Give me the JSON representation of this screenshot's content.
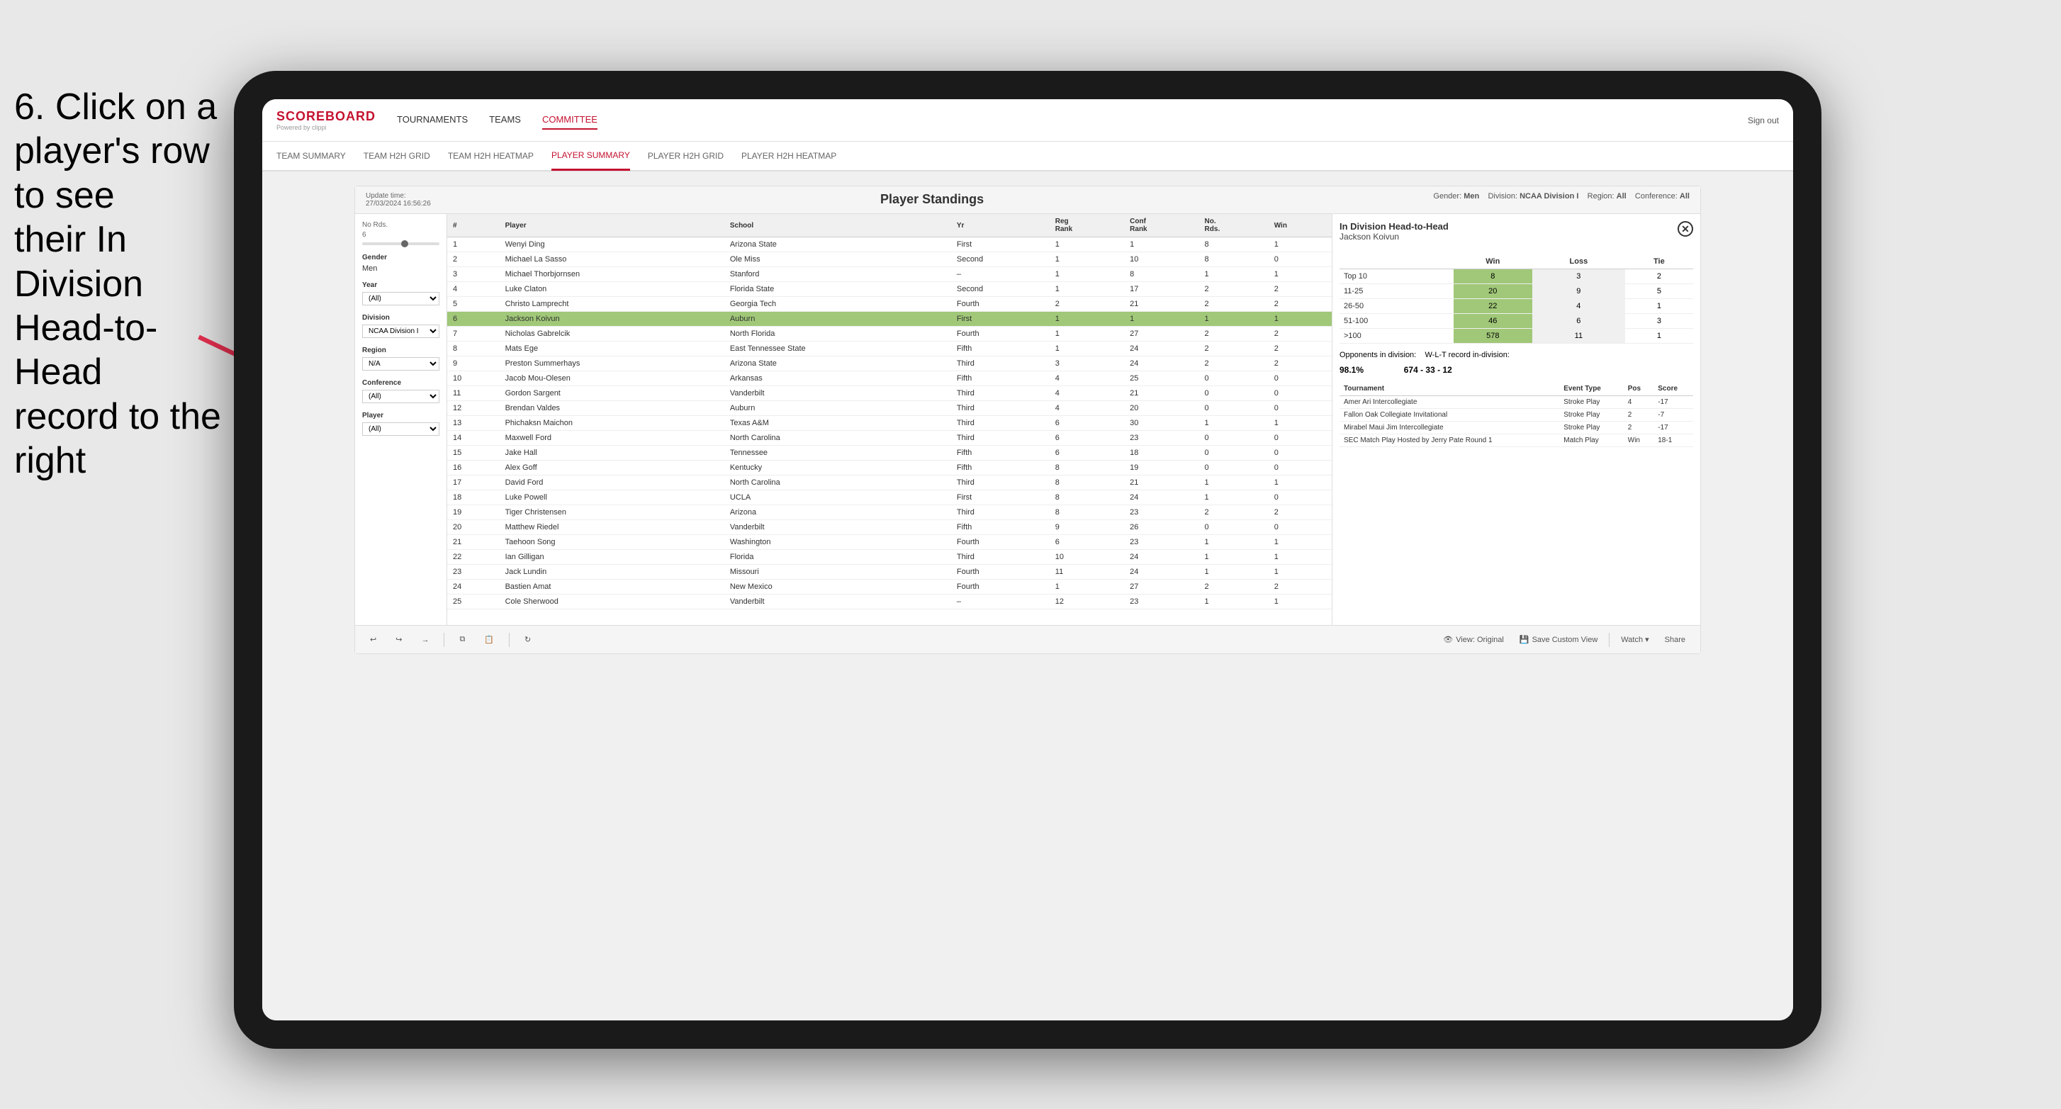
{
  "instruction": {
    "line1": "6. Click on a",
    "line2": "player's row to see",
    "line3": "their In Division",
    "line4": "Head-to-Head",
    "line5": "record to the right"
  },
  "nav": {
    "logo": "SCOREBOARD",
    "logo_sub": "Powered by clippi",
    "links": [
      "TOURNAMENTS",
      "TEAMS",
      "COMMITTEE"
    ],
    "active_link": "COMMITTEE",
    "sign_out": "Sign out"
  },
  "sub_nav": {
    "links": [
      "TEAM SUMMARY",
      "TEAM H2H GRID",
      "TEAM H2H HEATMAP",
      "PLAYER SUMMARY",
      "PLAYER H2H GRID",
      "PLAYER H2H HEATMAP"
    ],
    "active_link": "PLAYER SUMMARY"
  },
  "panel": {
    "update_time_label": "Update time:",
    "update_time": "27/03/2024 16:56:26",
    "title": "Player Standings",
    "gender_label": "Gender:",
    "gender": "Men",
    "division_label": "Division:",
    "division": "NCAA Division I",
    "region_label": "Region:",
    "region": "All",
    "conference_label": "Conference:",
    "conference": "All"
  },
  "filters": {
    "no_rds_label": "No Rds.",
    "no_rds_value": "6",
    "gender_label": "Gender",
    "gender_value": "Men",
    "year_label": "Year",
    "year_value": "(All)",
    "division_label": "Division",
    "division_value": "NCAA Division I",
    "region_label": "Region",
    "region_value": "N/A",
    "conference_label": "Conference",
    "conference_value": "(All)",
    "player_label": "Player",
    "player_value": "(All)"
  },
  "table": {
    "headers": [
      "#",
      "Player",
      "School",
      "Yr",
      "Reg Rank",
      "Conf Rank",
      "No. Rds.",
      "Win"
    ],
    "rows": [
      {
        "num": "1",
        "player": "Wenyi Ding",
        "school": "Arizona State",
        "yr": "First",
        "reg": "1",
        "conf": "1",
        "rds": "8",
        "win": "1",
        "highlighted": false
      },
      {
        "num": "2",
        "player": "Michael La Sasso",
        "school": "Ole Miss",
        "yr": "Second",
        "reg": "1",
        "conf": "10",
        "rds": "8",
        "win": "0",
        "highlighted": false
      },
      {
        "num": "3",
        "player": "Michael Thorbjornsen",
        "school": "Stanford",
        "yr": "–",
        "reg": "1",
        "conf": "8",
        "rds": "1",
        "win": "1",
        "highlighted": false
      },
      {
        "num": "4",
        "player": "Luke Claton",
        "school": "Florida State",
        "yr": "Second",
        "reg": "1",
        "conf": "17",
        "rds": "2",
        "win": "2",
        "highlighted": false
      },
      {
        "num": "5",
        "player": "Christo Lamprecht",
        "school": "Georgia Tech",
        "yr": "Fourth",
        "reg": "2",
        "conf": "21",
        "rds": "2",
        "win": "2",
        "highlighted": false
      },
      {
        "num": "6",
        "player": "Jackson Koivun",
        "school": "Auburn",
        "yr": "First",
        "reg": "1",
        "conf": "1",
        "rds": "1",
        "win": "1",
        "highlighted": true
      },
      {
        "num": "7",
        "player": "Nicholas Gabrelcik",
        "school": "North Florida",
        "yr": "Fourth",
        "reg": "1",
        "conf": "27",
        "rds": "2",
        "win": "2",
        "highlighted": false
      },
      {
        "num": "8",
        "player": "Mats Ege",
        "school": "East Tennessee State",
        "yr": "Fifth",
        "reg": "1",
        "conf": "24",
        "rds": "2",
        "win": "2",
        "highlighted": false
      },
      {
        "num": "9",
        "player": "Preston Summerhays",
        "school": "Arizona State",
        "yr": "Third",
        "reg": "3",
        "conf": "24",
        "rds": "2",
        "win": "2",
        "highlighted": false
      },
      {
        "num": "10",
        "player": "Jacob Mou-Olesen",
        "school": "Arkansas",
        "yr": "Fifth",
        "reg": "4",
        "conf": "25",
        "rds": "0",
        "win": "0",
        "highlighted": false
      },
      {
        "num": "11",
        "player": "Gordon Sargent",
        "school": "Vanderbilt",
        "yr": "Third",
        "reg": "4",
        "conf": "21",
        "rds": "0",
        "win": "0",
        "highlighted": false
      },
      {
        "num": "12",
        "player": "Brendan Valdes",
        "school": "Auburn",
        "yr": "Third",
        "reg": "4",
        "conf": "20",
        "rds": "0",
        "win": "0",
        "highlighted": false
      },
      {
        "num": "13",
        "player": "Phichaksn Maichon",
        "school": "Texas A&M",
        "yr": "Third",
        "reg": "6",
        "conf": "30",
        "rds": "1",
        "win": "1",
        "highlighted": false
      },
      {
        "num": "14",
        "player": "Maxwell Ford",
        "school": "North Carolina",
        "yr": "Third",
        "reg": "6",
        "conf": "23",
        "rds": "0",
        "win": "0",
        "highlighted": false
      },
      {
        "num": "15",
        "player": "Jake Hall",
        "school": "Tennessee",
        "yr": "Fifth",
        "reg": "6",
        "conf": "18",
        "rds": "0",
        "win": "0",
        "highlighted": false
      },
      {
        "num": "16",
        "player": "Alex Goff",
        "school": "Kentucky",
        "yr": "Fifth",
        "reg": "8",
        "conf": "19",
        "rds": "0",
        "win": "0",
        "highlighted": false
      },
      {
        "num": "17",
        "player": "David Ford",
        "school": "North Carolina",
        "yr": "Third",
        "reg": "8",
        "conf": "21",
        "rds": "1",
        "win": "1",
        "highlighted": false
      },
      {
        "num": "18",
        "player": "Luke Powell",
        "school": "UCLA",
        "yr": "First",
        "reg": "8",
        "conf": "24",
        "rds": "1",
        "win": "0",
        "highlighted": false
      },
      {
        "num": "19",
        "player": "Tiger Christensen",
        "school": "Arizona",
        "yr": "Third",
        "reg": "8",
        "conf": "23",
        "rds": "2",
        "win": "2",
        "highlighted": false
      },
      {
        "num": "20",
        "player": "Matthew Riedel",
        "school": "Vanderbilt",
        "yr": "Fifth",
        "reg": "9",
        "conf": "26",
        "rds": "0",
        "win": "0",
        "highlighted": false
      },
      {
        "num": "21",
        "player": "Taehoon Song",
        "school": "Washington",
        "yr": "Fourth",
        "reg": "6",
        "conf": "23",
        "rds": "1",
        "win": "1",
        "highlighted": false
      },
      {
        "num": "22",
        "player": "Ian Gilligan",
        "school": "Florida",
        "yr": "Third",
        "reg": "10",
        "conf": "24",
        "rds": "1",
        "win": "1",
        "highlighted": false
      },
      {
        "num": "23",
        "player": "Jack Lundin",
        "school": "Missouri",
        "yr": "Fourth",
        "reg": "11",
        "conf": "24",
        "rds": "1",
        "win": "1",
        "highlighted": false
      },
      {
        "num": "24",
        "player": "Bastien Amat",
        "school": "New Mexico",
        "yr": "Fourth",
        "reg": "1",
        "conf": "27",
        "rds": "2",
        "win": "2",
        "highlighted": false
      },
      {
        "num": "25",
        "player": "Cole Sherwood",
        "school": "Vanderbilt",
        "yr": "–",
        "reg": "12",
        "conf": "23",
        "rds": "1",
        "win": "1",
        "highlighted": false
      }
    ]
  },
  "h2h": {
    "title": "In Division Head-to-Head",
    "player": "Jackson Koivun",
    "close_icon": "✕",
    "win_label": "Win",
    "loss_label": "Loss",
    "tie_label": "Tie",
    "ranks": [
      {
        "label": "Top 10",
        "win": "8",
        "loss": "3",
        "tie": "2"
      },
      {
        "label": "11-25",
        "win": "20",
        "loss": "9",
        "tie": "5"
      },
      {
        "label": "26-50",
        "win": "22",
        "loss": "4",
        "tie": "1"
      },
      {
        "label": "51-100",
        "win": "46",
        "loss": "6",
        "tie": "3"
      },
      {
        "label": ">100",
        "win": "578",
        "loss": "11",
        "tie": "1"
      }
    ],
    "opponents_label": "Opponents in division:",
    "opponents_value": "98.1%",
    "record_label": "W-L-T record in-division:",
    "record_value": "674 - 33 - 12",
    "tournaments": [
      {
        "name": "Amer Ari Intercollegiate",
        "type": "Stroke Play",
        "pos": "4",
        "score": "-17"
      },
      {
        "name": "Fallon Oak Collegiate Invitational",
        "type": "Stroke Play",
        "pos": "2",
        "score": "-7"
      },
      {
        "name": "Mirabel Maui Jim Intercollegiate",
        "type": "Stroke Play",
        "pos": "2",
        "score": "-17"
      },
      {
        "name": "SEC Match Play Hosted by Jerry Pate Round 1",
        "type": "Match Play",
        "pos": "Win",
        "score": "18-1"
      }
    ],
    "tournament_headers": [
      "Tournament",
      "Event Type",
      "Pos",
      "Score"
    ]
  },
  "toolbar": {
    "undo": "↩",
    "redo": "↪",
    "forward": "→",
    "view_original": "View: Original",
    "save_custom": "Save Custom View",
    "watch": "Watch ▾",
    "share": "Share"
  }
}
